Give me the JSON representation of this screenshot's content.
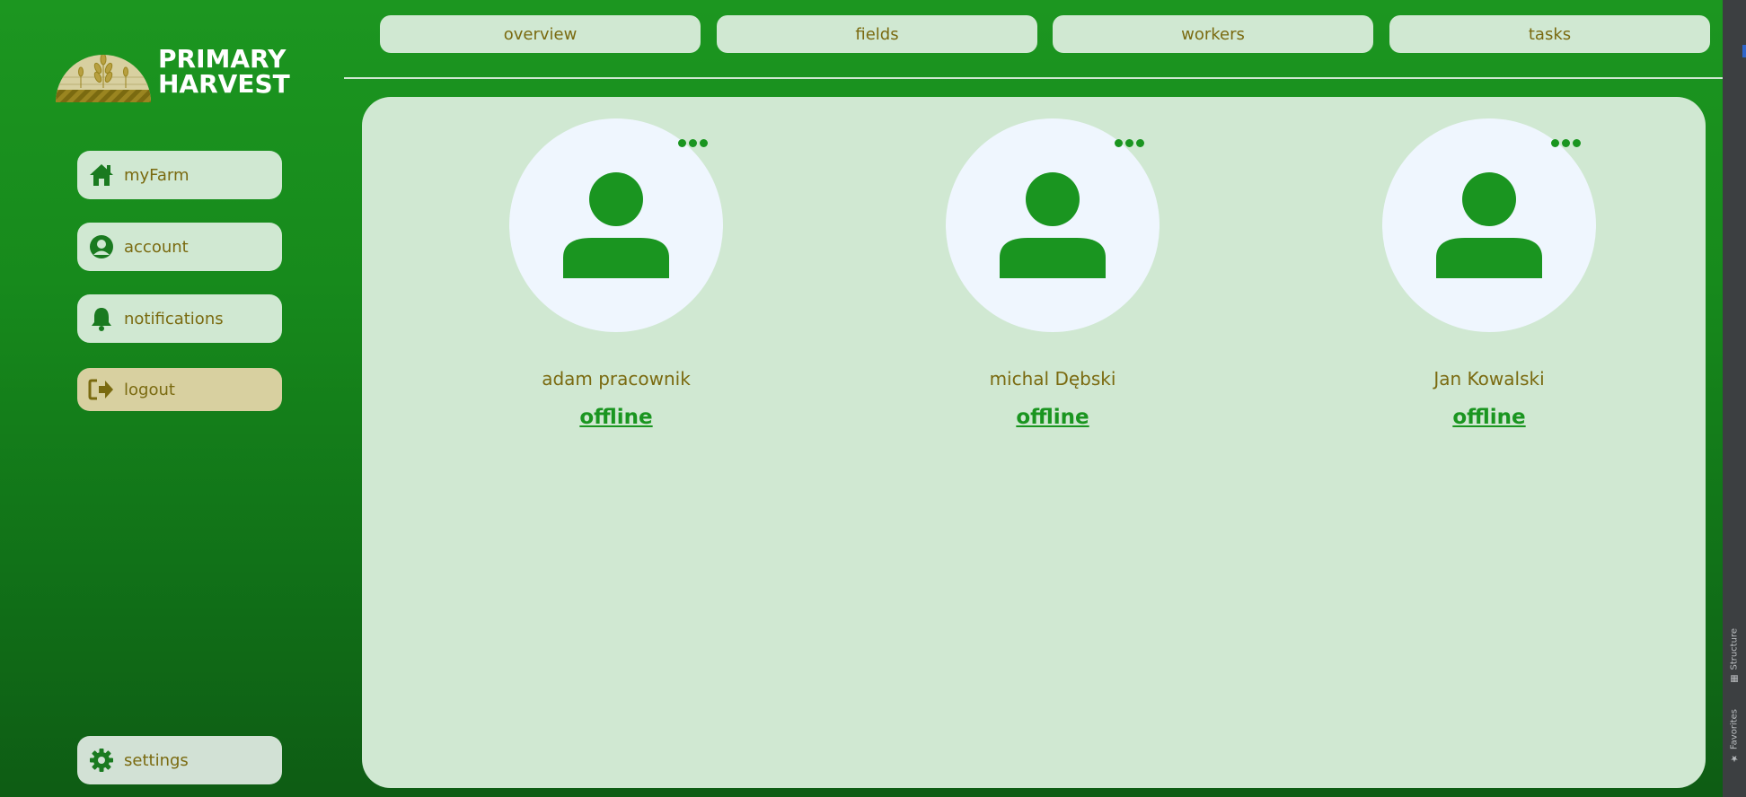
{
  "brand": {
    "line1": "PRIMARY",
    "line2": "HARVEST"
  },
  "sidebar": {
    "items": [
      {
        "label": "myFarm",
        "icon": "home-icon"
      },
      {
        "label": "account",
        "icon": "user-circle-icon"
      },
      {
        "label": "notifications",
        "icon": "bell-icon"
      },
      {
        "label": "logout",
        "icon": "logout-icon"
      }
    ],
    "settings": {
      "label": "settings",
      "icon": "gear-icon"
    }
  },
  "tabs": [
    {
      "label": "overview"
    },
    {
      "label": "fields"
    },
    {
      "label": "workers"
    },
    {
      "label": "tasks"
    }
  ],
  "workers": [
    {
      "name": "adam pracownik",
      "status": "offline"
    },
    {
      "name": "michal Dębski",
      "status": "offline"
    },
    {
      "name": "Jan Kowalski",
      "status": "offline"
    }
  ],
  "ide_sidebar": {
    "structure_label": "Structure",
    "favorites_label": "Favorites"
  },
  "colors": {
    "background_green": "#1a9520",
    "panel": "#d0e8d2",
    "text_olive": "#7a6a10",
    "logout_tan": "#d8d0a0",
    "avatar_bg": "#eff6fe"
  }
}
